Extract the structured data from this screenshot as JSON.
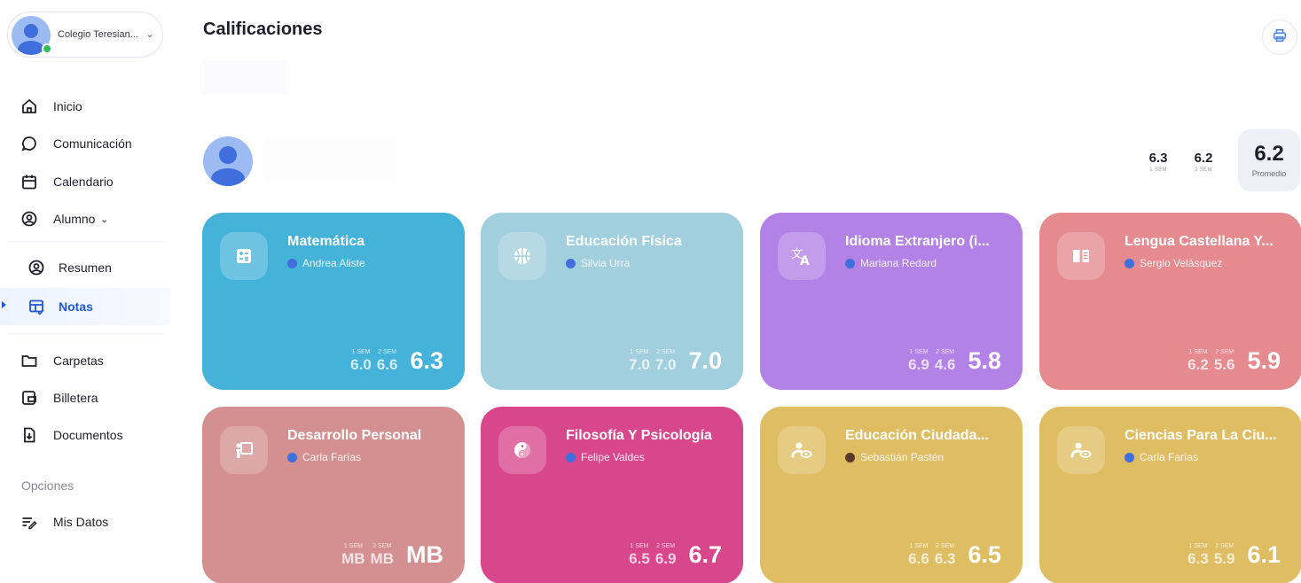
{
  "school": {
    "name": "Colegio Teresian...",
    "status_color": "#2fbd5c"
  },
  "nav": {
    "inicio": "Inicio",
    "comunicacion": "Comunicación",
    "calendario": "Calendario",
    "alumno": "Alumno",
    "resumen": "Resumen",
    "notas": "Notas",
    "carpetas": "Carpetas",
    "billetera": "Billetera",
    "documentos": "Documentos",
    "options_title": "Opciones",
    "mis_datos": "Mis Datos"
  },
  "page": {
    "title": "Calificaciones"
  },
  "summary": {
    "sem1": "6.3",
    "sem1_label": "1 SEM",
    "sem2": "6.2",
    "sem2_label": "2 SEM",
    "avg": "6.2",
    "avg_label": "Promedio"
  },
  "sem_labels": {
    "s1": "1 SEM",
    "s2": "2 SEM"
  },
  "courses": [
    {
      "name": "Matemática",
      "teacher": "Andrea Aliste",
      "sem1": "6.0",
      "sem2": "6.6",
      "final": "6.3",
      "color": "#45b2d9",
      "icon": "calculator-icon"
    },
    {
      "name": "Educación Física",
      "teacher": "Silvia Urra",
      "sem1": "7.0",
      "sem2": "7.0",
      "final": "7.0",
      "color": "#a2cfdd",
      "icon": "basketball-icon"
    },
    {
      "name": "Idioma Extranjero (i...",
      "teacher": "Mariana Redard",
      "sem1": "6.9",
      "sem2": "4.6",
      "final": "5.8",
      "color": "#b382e6",
      "icon": "translate-icon"
    },
    {
      "name": "Lengua Castellana Y...",
      "teacher": "Sergio Velásquez",
      "sem1": "6.2",
      "sem2": "5.6",
      "final": "5.9",
      "color": "#e58a8e",
      "icon": "book-icon"
    },
    {
      "name": "Desarrollo Personal",
      "teacher": "Carla Farías",
      "sem1": "MB",
      "sem2": "MB",
      "final": "MB",
      "color": "#d49090",
      "icon": "teacher-board-icon"
    },
    {
      "name": "Filosofía Y Psicología",
      "teacher": "Felipe Valdes",
      "sem1": "6.5",
      "sem2": "6.9",
      "final": "6.7",
      "color": "#d8478c",
      "icon": "yin-yang-icon"
    },
    {
      "name": "Educación Ciudada...",
      "teacher": "Sebastián Pastén",
      "sem1": "6.6",
      "sem2": "6.3",
      "final": "6.5",
      "color": "#dfbd63",
      "icon": "person-view-icon"
    },
    {
      "name": "Ciencias Para La Ciu...",
      "teacher": "Carla Farías",
      "sem1": "6.3",
      "sem2": "5.9",
      "final": "6.1",
      "color": "#dfbd63",
      "icon": "person-view-icon"
    }
  ]
}
